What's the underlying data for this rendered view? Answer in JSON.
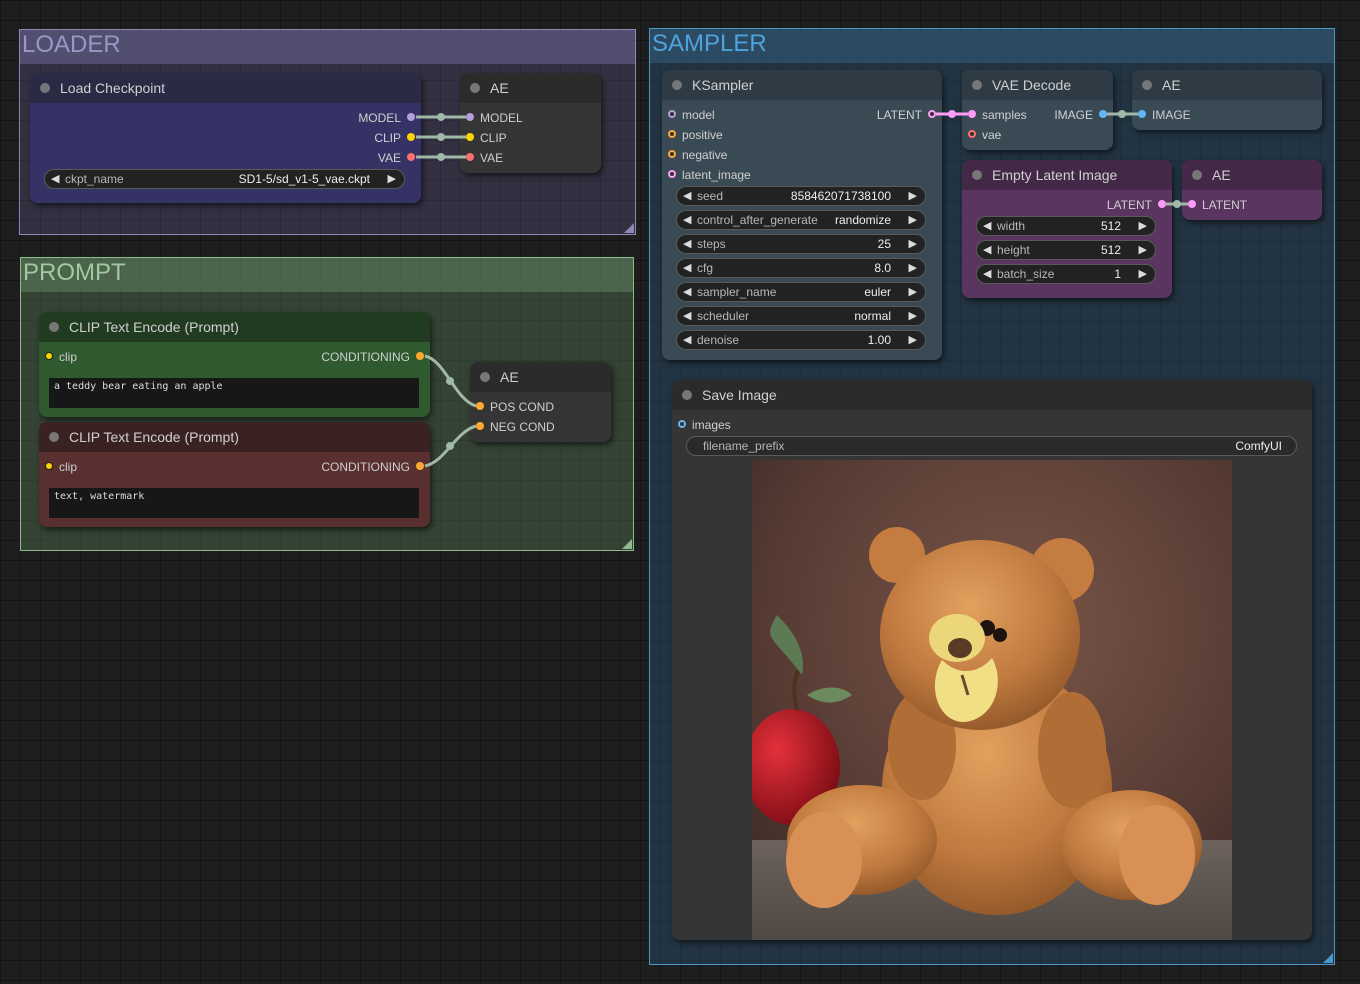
{
  "groups": {
    "loader": {
      "title": "LOADER",
      "color": "#8c88b8"
    },
    "prompt": {
      "title": "PROMPT",
      "color": "#8fb88f"
    },
    "sampler": {
      "title": "SAMPLER",
      "color": "#4a97c9"
    }
  },
  "nodes": {
    "load_checkpoint": {
      "title": "Load Checkpoint",
      "outputs": [
        "MODEL",
        "CLIP",
        "VAE"
      ],
      "widget": {
        "label": "ckpt_name",
        "value": "SD1-5/sd_v1-5_vae.ckpt"
      }
    },
    "ae_loader": {
      "title": "AE",
      "inputs": [
        "MODEL",
        "CLIP",
        "VAE"
      ]
    },
    "clip_pos": {
      "title": "CLIP Text Encode (Prompt)",
      "input": "clip",
      "output": "CONDITIONING",
      "text": "a teddy bear eating an apple"
    },
    "clip_neg": {
      "title": "CLIP Text Encode (Prompt)",
      "input": "clip",
      "output": "CONDITIONING",
      "text": "text, watermark"
    },
    "ae_prompt": {
      "title": "AE",
      "inputs": [
        "POS COND",
        "NEG COND"
      ]
    },
    "ksampler": {
      "title": "KSampler",
      "inputs": [
        "model",
        "positive",
        "negative",
        "latent_image"
      ],
      "output": "LATENT",
      "widgets": [
        {
          "label": "seed",
          "value": "858462071738100"
        },
        {
          "label": "control_after_generate",
          "value": "randomize"
        },
        {
          "label": "steps",
          "value": "25"
        },
        {
          "label": "cfg",
          "value": "8.0"
        },
        {
          "label": "sampler_name",
          "value": "euler"
        },
        {
          "label": "scheduler",
          "value": "normal"
        },
        {
          "label": "denoise",
          "value": "1.00"
        }
      ]
    },
    "vae_decode": {
      "title": "VAE Decode",
      "inputs": [
        "samples",
        "vae"
      ],
      "output": "IMAGE"
    },
    "ae_image": {
      "title": "AE",
      "input": "IMAGE"
    },
    "empty_latent": {
      "title": "Empty Latent Image",
      "output": "LATENT",
      "widgets": [
        {
          "label": "width",
          "value": "512"
        },
        {
          "label": "height",
          "value": "512"
        },
        {
          "label": "batch_size",
          "value": "1"
        }
      ]
    },
    "ae_latent": {
      "title": "AE",
      "input": "LATENT"
    },
    "save_image": {
      "title": "Save Image",
      "input": "images",
      "widget": {
        "label": "filename_prefix",
        "value": "ComfyUI"
      },
      "preview_icon": "teddy-bear-eating-apple-image"
    }
  },
  "slot_colors": {
    "MODEL": "#b39ddb",
    "CLIP": "#ffd500",
    "VAE": "#ff6e6e",
    "CONDITIONING": "#ffa931",
    "LATENT": "#ff9cf9",
    "IMAGE": "#64b5f6"
  }
}
